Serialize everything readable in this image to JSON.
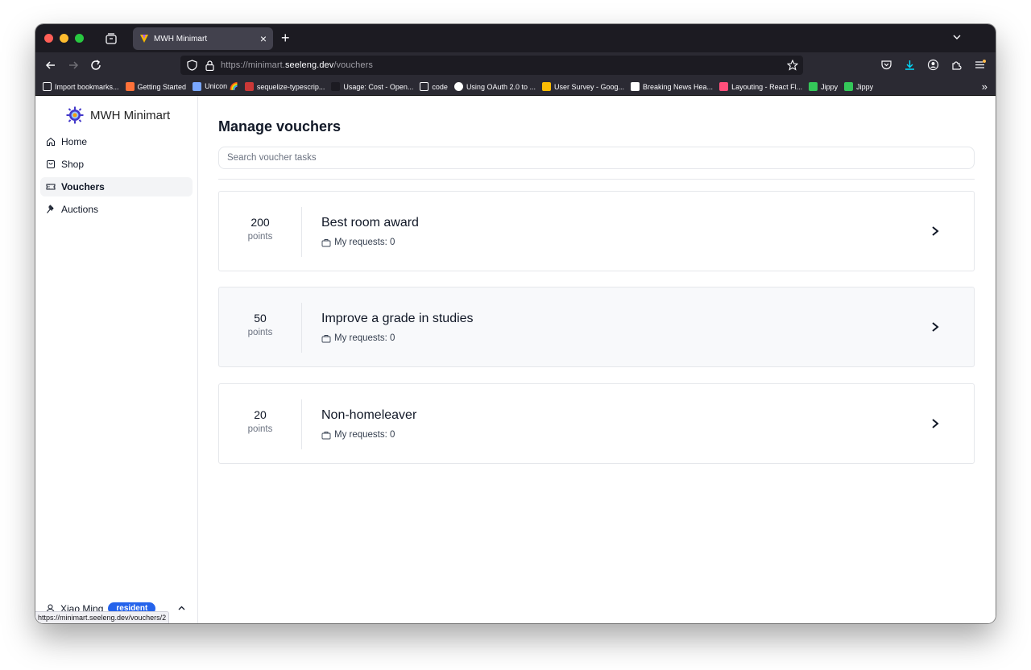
{
  "browser": {
    "tab_title": "MWH Minimart",
    "url_prefix": "https://minimart.",
    "url_domain": "seeleng.dev",
    "url_path": "/vouchers",
    "bookmarks": [
      {
        "label": "Import bookmarks...",
        "icon": "import-icon",
        "color": "#fbfbfe"
      },
      {
        "label": "Getting Started",
        "icon": "firefox-icon",
        "color": "#ff7139"
      },
      {
        "label": "Unicon 🌈",
        "icon": "unicon-icon",
        "color": "#7aa7ff"
      },
      {
        "label": "sequelize-typescrip...",
        "icon": "npm-icon",
        "color": "#cb3837"
      },
      {
        "label": "Usage: Cost - Open...",
        "icon": "openai-icon",
        "color": "#1c1b22"
      },
      {
        "label": "code",
        "icon": "folder-icon",
        "color": "#fbfbfe"
      },
      {
        "label": "Using OAuth 2.0 to ...",
        "icon": "google-icon",
        "color": "#ffffff"
      },
      {
        "label": "User Survey - Goog...",
        "icon": "drive-icon",
        "color": "#fbbc04"
      },
      {
        "label": "Breaking News Hea...",
        "icon": "news-icon",
        "color": "#ffffff"
      },
      {
        "label": "Layouting - React Fl...",
        "icon": "reactflow-icon",
        "color": "#ff4f7b"
      },
      {
        "label": "Jippy",
        "icon": "jippy-icon",
        "color": "#34c759"
      },
      {
        "label": "Jippy",
        "icon": "jippy-icon",
        "color": "#34c759"
      }
    ],
    "status_url": "https://minimart.seeleng.dev/vouchers/2"
  },
  "sidebar": {
    "brand": "MWH Minimart",
    "items": [
      {
        "label": "Home",
        "icon": "home-icon"
      },
      {
        "label": "Shop",
        "icon": "shopping-bag-icon"
      },
      {
        "label": "Vouchers",
        "icon": "ticket-icon"
      },
      {
        "label": "Auctions",
        "icon": "gavel-icon"
      }
    ],
    "active": "Vouchers",
    "user": {
      "name": "Xiao Ming",
      "role": "resident"
    }
  },
  "main": {
    "title": "Manage vouchers",
    "search_placeholder": "Search voucher tasks",
    "vouchers": [
      {
        "points": "200",
        "unit": "points",
        "title": "Best room award",
        "requests": "My requests: 0"
      },
      {
        "points": "50",
        "unit": "points",
        "title": "Improve a grade in studies",
        "requests": "My requests: 0"
      },
      {
        "points": "20",
        "unit": "points",
        "title": "Non-homeleaver",
        "requests": "My requests: 0"
      }
    ]
  },
  "colors": {
    "accent": "#2563eb",
    "tab_bg": "#42414d",
    "toolbar_bg": "#2b2a33"
  }
}
